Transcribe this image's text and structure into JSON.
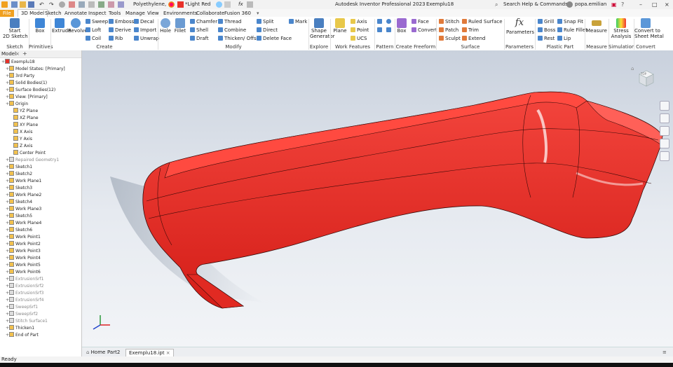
{
  "titlebar": {
    "material": "Polyethylene,",
    "appearance": "*Light Red",
    "fx": "fx",
    "app_title": "Autodesk Inventor Professional 2023",
    "doc_title": "Exemplu18",
    "search_placeholder": "Search Help & Commands...",
    "user": "popa.emilian"
  },
  "tabs": [
    "File",
    "3D Model",
    "Sketch",
    "Annotate",
    "Inspect",
    "Tools",
    "Manage",
    "View",
    "Environments",
    "Collaborate",
    "Fusion 360"
  ],
  "ribbon": {
    "sketch": {
      "start": "Start",
      "sketch2d": "2D Sketch",
      "label": "Sketch"
    },
    "primitives": {
      "box": "Box",
      "label": "Primitives"
    },
    "create": {
      "extrude": "Extrude",
      "revolve": "Revolve",
      "sweep": "Sweep",
      "loft": "Loft",
      "coil": "Coil",
      "emboss": "Emboss",
      "derive": "Derive",
      "rib": "Rib",
      "decal": "Decal",
      "import": "Import",
      "unwrap": "Unwrap",
      "label": "Create"
    },
    "modify": {
      "hole": "Hole",
      "fillet": "Fillet",
      "chamfer": "Chamfer",
      "shell": "Shell",
      "draft": "Draft",
      "thread": "Thread",
      "combine": "Combine",
      "thicken": "Thicken/ Offset",
      "split": "Split",
      "direct": "Direct",
      "delete_face": "Delete Face",
      "mark": "Mark",
      "label": "Modify"
    },
    "explore": {
      "shape1": "Shape",
      "shape2": "Generator",
      "label": "Explore"
    },
    "work": {
      "plane": "Plane",
      "axis": "Axis",
      "point": "Point",
      "ucs": "UCS",
      "label": "Work Features"
    },
    "pattern": {
      "label": "Pattern"
    },
    "freeform": {
      "box": "Box",
      "face": "Face",
      "convert": "Convert",
      "label": "Create Freeform"
    },
    "surface": {
      "stitch": "Stitch",
      "patch": "Patch",
      "sculpt": "Sculpt",
      "ruled": "Ruled Surface",
      "trim": "Trim",
      "extend": "Extend",
      "label": "Surface"
    },
    "parameters": {
      "fx": "fx",
      "params": "Parameters",
      "label": "Parameters"
    },
    "plastic": {
      "grill": "Grill",
      "boss": "Boss",
      "rest": "Rest",
      "snap": "Snap Fit",
      "rule_fillet": "Rule Fillet",
      "lip": "Lip",
      "label": "Plastic Part"
    },
    "measure": {
      "measure": "Measure",
      "label": "Measure"
    },
    "simulation": {
      "stress1": "Stress",
      "stress2": "Analysis",
      "label": "Simulation"
    },
    "convert": {
      "c1": "Convert to",
      "c2": "Sheet Metal",
      "label": "Convert"
    }
  },
  "browser": {
    "tab": "Model",
    "add": "+",
    "items": [
      {
        "label": "Exemplu18",
        "level": 0,
        "gray": false
      },
      {
        "label": "Model States: [Primary]",
        "level": 1,
        "gray": false
      },
      {
        "label": "3rd Party",
        "level": 1,
        "gray": false
      },
      {
        "label": "Solid Bodies(1)",
        "level": 1,
        "gray": false
      },
      {
        "label": "Surface Bodies(12)",
        "level": 1,
        "gray": false
      },
      {
        "label": "View: [Primary]",
        "level": 1,
        "gray": false
      },
      {
        "label": "Origin",
        "level": 1,
        "gray": false
      },
      {
        "label": "YZ Plane",
        "level": 2,
        "gray": false
      },
      {
        "label": "XZ Plane",
        "level": 2,
        "gray": false
      },
      {
        "label": "XY Plane",
        "level": 2,
        "gray": false
      },
      {
        "label": "X Axis",
        "level": 2,
        "gray": false
      },
      {
        "label": "Y Axis",
        "level": 2,
        "gray": false
      },
      {
        "label": "Z Axis",
        "level": 2,
        "gray": false
      },
      {
        "label": "Center Point",
        "level": 2,
        "gray": false
      },
      {
        "label": "Repaired Geometry1",
        "level": 1,
        "gray": true
      },
      {
        "label": "Sketch1",
        "level": 1,
        "gray": false
      },
      {
        "label": "Sketch2",
        "level": 1,
        "gray": false
      },
      {
        "label": "Work Plane1",
        "level": 1,
        "gray": false
      },
      {
        "label": "Sketch3",
        "level": 1,
        "gray": false
      },
      {
        "label": "Work Plane2",
        "level": 1,
        "gray": false
      },
      {
        "label": "Sketch4",
        "level": 1,
        "gray": false
      },
      {
        "label": "Work Plane3",
        "level": 1,
        "gray": false
      },
      {
        "label": "Sketch5",
        "level": 1,
        "gray": false
      },
      {
        "label": "Work Plane4",
        "level": 1,
        "gray": false
      },
      {
        "label": "Sketch6",
        "level": 1,
        "gray": false
      },
      {
        "label": "Work Point1",
        "level": 1,
        "gray": false
      },
      {
        "label": "Work Point2",
        "level": 1,
        "gray": false
      },
      {
        "label": "Work Point3",
        "level": 1,
        "gray": false
      },
      {
        "label": "Work Point4",
        "level": 1,
        "gray": false
      },
      {
        "label": "Work Point5",
        "level": 1,
        "gray": false
      },
      {
        "label": "Work Point6",
        "level": 1,
        "gray": false
      },
      {
        "label": "ExtrusionSrf1",
        "level": 1,
        "gray": true
      },
      {
        "label": "ExtrusionSrf2",
        "level": 1,
        "gray": true
      },
      {
        "label": "ExtrusionSrf3",
        "level": 1,
        "gray": true
      },
      {
        "label": "ExtrusionSrf4",
        "level": 1,
        "gray": true
      },
      {
        "label": "SweepSrf1",
        "level": 1,
        "gray": true
      },
      {
        "label": "SweepSrf2",
        "level": 1,
        "gray": true
      },
      {
        "label": "Stitch Surface1",
        "level": 1,
        "gray": true
      },
      {
        "label": "Thicken1",
        "level": 1,
        "gray": false
      },
      {
        "label": "End of Part",
        "level": 1,
        "gray": false
      }
    ]
  },
  "viewcube": {
    "face": "TOP"
  },
  "doctabs": {
    "home": "Home",
    "part2": "Part2",
    "active": "Exemplu18.ipt"
  },
  "status": "Ready",
  "colors": {
    "part": "#e8312a",
    "accent": "#f0a020"
  }
}
